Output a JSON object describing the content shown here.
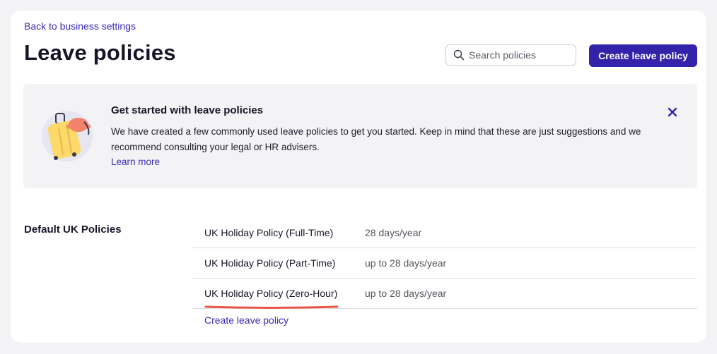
{
  "nav": {
    "back_label": "Back to business settings"
  },
  "header": {
    "title": "Leave policies",
    "search_placeholder": "Search policies",
    "create_button": "Create leave policy"
  },
  "banner": {
    "title": "Get started with leave policies",
    "text": "We have created a few commonly used leave policies to get you started. Keep in mind that these are just suggestions and we recommend consulting your legal or HR advisers.",
    "learn_more": "Learn more",
    "illustration": "suitcase-illustration",
    "close_icon": "close-icon"
  },
  "section": {
    "title": "Default UK Policies",
    "policies": [
      {
        "name": "UK Holiday Policy (Full-Time)",
        "days": "28 days/year"
      },
      {
        "name": "UK Holiday Policy (Part-Time)",
        "days": "up to 28 days/year"
      },
      {
        "name": "UK Holiday Policy (Zero-Hour)",
        "days": "up to 28 days/year"
      }
    ],
    "create_link": "Create leave policy"
  },
  "colors": {
    "accent": "#3322aa",
    "link": "#3b2bb5",
    "banner_bg": "#f3f3f5",
    "annotation_underline": "#e8574c"
  }
}
